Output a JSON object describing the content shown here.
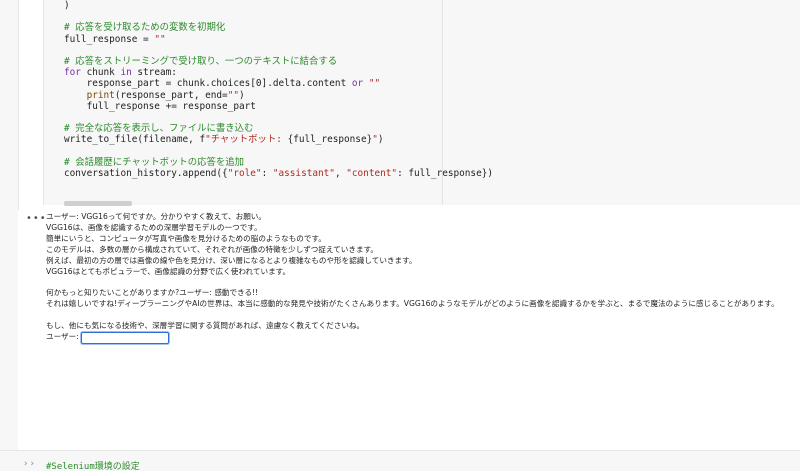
{
  "code_cell": {
    "lines": [
      {
        "segments": [
          {
            "t": ")",
            "c": "pl"
          }
        ]
      },
      {
        "segments": []
      },
      {
        "segments": [
          {
            "t": "# 応答を受け取るための変数を初期化",
            "c": "cm"
          }
        ]
      },
      {
        "segments": [
          {
            "t": "full_response = ",
            "c": "pl"
          },
          {
            "t": "\"\"",
            "c": "st"
          }
        ]
      },
      {
        "segments": []
      },
      {
        "segments": [
          {
            "t": "# 応答をストリーミングで受け取り、一つのテキストに結合する",
            "c": "cm"
          }
        ]
      },
      {
        "segments": [
          {
            "t": "for",
            "c": "kw"
          },
          {
            "t": " chunk ",
            "c": "pl"
          },
          {
            "t": "in",
            "c": "kw"
          },
          {
            "t": " stream:",
            "c": "pl"
          }
        ]
      },
      {
        "segments": [
          {
            "t": "    response_part = chunk.choices[0].delta.content ",
            "c": "pl"
          },
          {
            "t": "or",
            "c": "kw"
          },
          {
            "t": " ",
            "c": "pl"
          },
          {
            "t": "\"\"",
            "c": "st"
          }
        ]
      },
      {
        "segments": [
          {
            "t": "    ",
            "c": "pl"
          },
          {
            "t": "print",
            "c": "fn"
          },
          {
            "t": "(response_part, end=",
            "c": "pl"
          },
          {
            "t": "\"\"",
            "c": "st"
          },
          {
            "t": ")",
            "c": "pl"
          }
        ]
      },
      {
        "segments": [
          {
            "t": "    full_response += response_part",
            "c": "pl"
          }
        ]
      },
      {
        "segments": []
      },
      {
        "segments": [
          {
            "t": "# 完全な応答を表示し、ファイルに書き込む",
            "c": "cm"
          }
        ]
      },
      {
        "segments": [
          {
            "t": "write_to_file(filename, f",
            "c": "pl"
          },
          {
            "t": "\"チャットボット: ",
            "c": "st"
          },
          {
            "t": "{full_response}",
            "c": "pl"
          },
          {
            "t": "\"",
            "c": "st"
          },
          {
            "t": ")",
            "c": "pl"
          }
        ]
      },
      {
        "segments": []
      },
      {
        "segments": [
          {
            "t": "# 会話履歴にチャットボットの応答を追加",
            "c": "cm"
          }
        ]
      },
      {
        "segments": [
          {
            "t": "conversation_history.append({",
            "c": "pl"
          },
          {
            "t": "\"role\"",
            "c": "st"
          },
          {
            "t": ": ",
            "c": "pl"
          },
          {
            "t": "\"assistant\"",
            "c": "st"
          },
          {
            "t": ", ",
            "c": "pl"
          },
          {
            "t": "\"content\"",
            "c": "st"
          },
          {
            "t": ": full_response})",
            "c": "pl"
          }
        ]
      }
    ]
  },
  "output": {
    "more_icon": "•••",
    "lines": [
      "ユーザー: VGG16って何ですか。分かりやすく教えて、お願い。",
      "VGG16は、画像を認識するための深層学習モデルの一つです。",
      "簡単にいうと、コンピュータが写真や画像を見分けるための脳のようなものです。",
      "このモデルは、多数の層から構成されていて、それぞれが画像の特徴を少しずつ捉えていきます。",
      "例えば、最初の方の層では画像の線や色を見分け、深い層になるとより複雑なものや形を認識していきます。",
      "VGG16はとてもポピュラーで、画像認識の分野で広く使われています。",
      "",
      "何かもっと知りたいことがありますか?ユーザー: 感動できる!!",
      "それは嬉しいですね!ディープラーニングやAIの世界は、本当に感動的な発見や技術がたくさんあります。VGG16のようなモデルがどのように画像を認識するかを学ぶと、まるで魔法のように感じることがあります。",
      "",
      "もし、他にも気になる技術や、深層学習に関する質問があれば、遠慮なく教えてくださいね。"
    ],
    "input_prompt": "ユーザー:",
    "input_value": ""
  },
  "next_cell": {
    "chevrons": "› ›",
    "text": "#Selenium環境の設定"
  }
}
